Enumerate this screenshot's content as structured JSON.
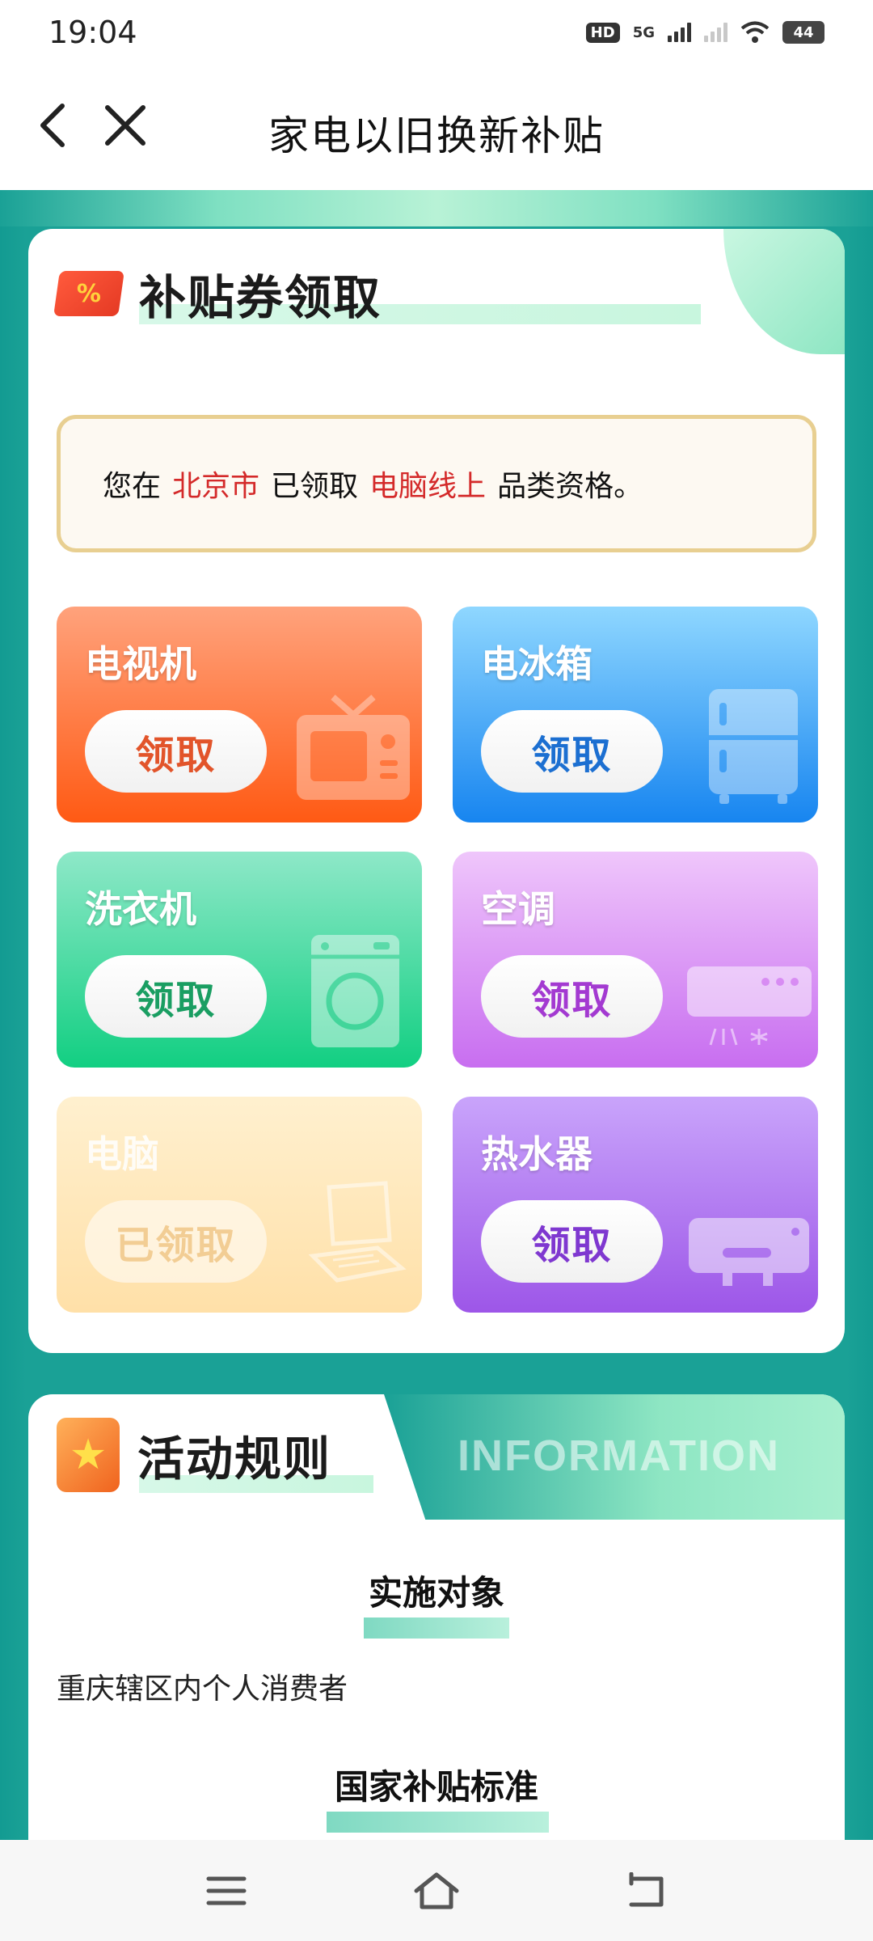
{
  "status_bar": {
    "time": "19:04",
    "hd_label": "HD",
    "network": "5G",
    "battery": "44"
  },
  "header": {
    "title": "家电以旧换新补贴"
  },
  "coupon_section": {
    "title": "补贴券领取",
    "icon_symbol": "%",
    "info": {
      "prefix": "您在",
      "city": "北京市",
      "middle": "已领取",
      "category": "电脑线上",
      "suffix": "品类资格。"
    },
    "tiles": [
      {
        "name": "电视机",
        "button": "领取"
      },
      {
        "name": "电冰箱",
        "button": "领取"
      },
      {
        "name": "洗衣机",
        "button": "领取"
      },
      {
        "name": "空调",
        "button": "领取"
      },
      {
        "name": "电脑",
        "button": "已领取"
      },
      {
        "name": "热水器",
        "button": "领取"
      }
    ]
  },
  "rules_section": {
    "title": "活动规则",
    "watermark": "INFORMATION",
    "subsections": [
      {
        "heading": "实施对象",
        "text": "重庆辖区内个人消费者"
      },
      {
        "heading": "国家补贴标准"
      }
    ]
  },
  "colors": {
    "highlight_red": "#d42a2a",
    "teal": "#1aa196",
    "info_border": "#e8cf91"
  }
}
